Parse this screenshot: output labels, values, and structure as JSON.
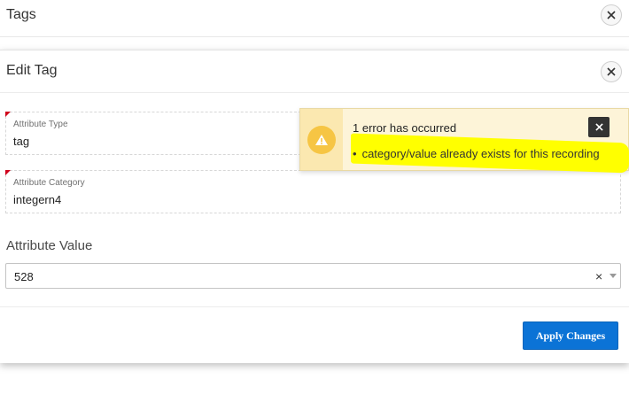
{
  "tags_dialog": {
    "title": "Tags"
  },
  "edit_dialog": {
    "title": "Edit Tag",
    "attribute_type": {
      "label": "Attribute Type",
      "value": "tag",
      "required": true
    },
    "attribute_category": {
      "label": "Attribute Category",
      "value": "integern4",
      "required": true
    },
    "attribute_value": {
      "label": "Attribute Value",
      "selected": "528",
      "clear_glyph": "×"
    },
    "apply_button_label": "Apply Changes"
  },
  "error": {
    "title": "1 error has occurred",
    "messages": [
      "category/value already exists for this recording"
    ],
    "bullet": "•",
    "highlight_color": "#ffff00"
  },
  "colors": {
    "primary": "#0b73d6",
    "warning": "#f6c544",
    "required_marker": "#d0021b"
  },
  "icons": [
    "close-icon",
    "warning-icon",
    "chevron-down-icon"
  ]
}
